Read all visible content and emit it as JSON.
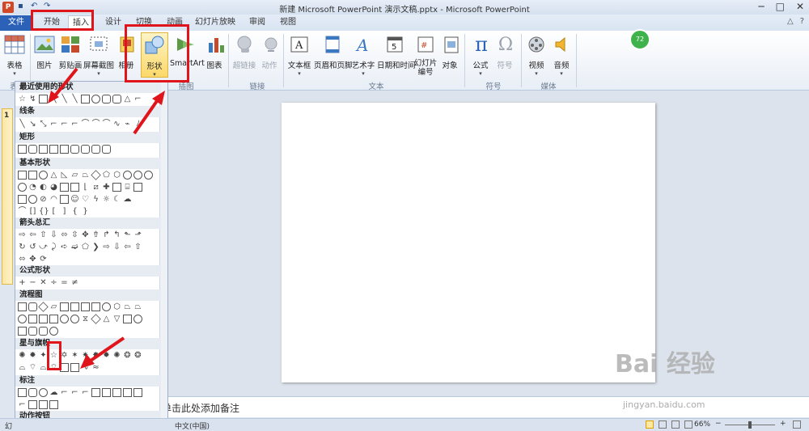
{
  "window": {
    "title": "新建 Microsoft PowerPoint 演示文稿.pptx - Microsoft PowerPoint",
    "app_icon": "P"
  },
  "tabs": [
    "文件",
    "开始",
    "插入",
    "设计",
    "切换",
    "动画",
    "幻灯片放映",
    "审阅",
    "视图"
  ],
  "ribbon": {
    "buttons": [
      {
        "label": "表格",
        "icon": "table-icon"
      },
      {
        "label": "图片",
        "icon": "picture-icon"
      },
      {
        "label": "剪贴画",
        "icon": "clipart-icon"
      },
      {
        "label": "屏幕截图",
        "icon": "screenshot-icon"
      },
      {
        "label": "相册",
        "icon": "album-icon"
      },
      {
        "label": "形状",
        "icon": "shapes-icon"
      },
      {
        "label": "SmartArt",
        "icon": "smartart-icon"
      },
      {
        "label": "图表",
        "icon": "chart-icon"
      },
      {
        "label": "超链接",
        "icon": "hyperlink-icon"
      },
      {
        "label": "动作",
        "icon": "action-icon"
      },
      {
        "label": "文本框",
        "icon": "textbox-icon"
      },
      {
        "label": "页眉和页脚",
        "icon": "header-footer-icon"
      },
      {
        "label": "艺术字",
        "icon": "wordart-icon"
      },
      {
        "label": "日期和时间",
        "icon": "datetime-icon"
      },
      {
        "label": "幻灯片编号",
        "icon": "slide-number-icon"
      },
      {
        "label": "对象",
        "icon": "object-icon"
      },
      {
        "label": "公式",
        "icon": "equation-icon"
      },
      {
        "label": "符号",
        "icon": "symbol-icon"
      },
      {
        "label": "视频",
        "icon": "video-icon"
      },
      {
        "label": "音频",
        "icon": "audio-icon"
      }
    ],
    "groups": [
      "表",
      "插图",
      "链接",
      "文本",
      "符号",
      "媒体"
    ]
  },
  "shapes_panel": {
    "sections": [
      "最近使用的形状",
      "线条",
      "矩形",
      "基本形状",
      "箭头总汇",
      "公式形状",
      "流程图",
      "星与旗帜",
      "标注",
      "动作按钮"
    ]
  },
  "slide_thumb_number": "1",
  "notes_placeholder": "单击此处添加备注",
  "status": {
    "left": "幻",
    "language": "中文(中国)",
    "zoom": "66%"
  },
  "watermark": {
    "text": "Bai 经验",
    "sub": "jingyan.baidu.com"
  },
  "colors": {
    "accent": "#2b62b8",
    "annotation": "#e0141b",
    "shapes_highlight": "#fbd86a"
  }
}
